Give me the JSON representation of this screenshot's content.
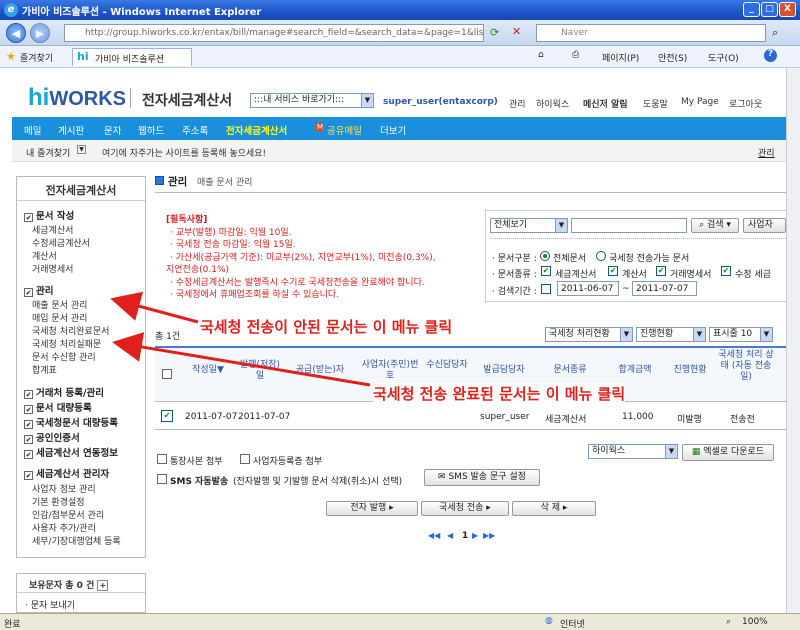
{
  "window": {
    "title": "가비아 비즈솔루션 - Windows Internet Explorer",
    "min": "_",
    "max": "□",
    "close": "X"
  },
  "browser": {
    "address": "http://group.hiworks.co.kr/entax/bill/manage#search_field=&search_data=&page=1&listcoun",
    "search_placeholder": "Naver",
    "favorites": "즐겨찾기",
    "tab": "가비아 비즈솔루션",
    "menu": {
      "page": "페이지(P)",
      "safety": "안전(S)",
      "tools": "도구(O)",
      "help": "?"
    }
  },
  "header": {
    "logo_hi": "hi",
    "logo_works": "WORKS",
    "service": "전자세금계산서",
    "shortcut": ":::내 서비스 바로가기:::",
    "user": "super_user(entaxcorp)",
    "links": [
      "관리",
      "하이웍스",
      "메신저 알림",
      "도움말",
      "My Page",
      "로그아웃"
    ]
  },
  "nav": {
    "items": [
      "메일",
      "게시판",
      "문자",
      "웹하드",
      "주소록",
      "전자세금계산서",
      "공유메일",
      "더보기"
    ]
  },
  "favbar": {
    "label": "내 즐겨찾기",
    "text": "여기에 자주가는 사이트를 등록해 놓으세요!",
    "manage": "관리"
  },
  "sidebar": {
    "title": "전자세금계산서",
    "sections": [
      {
        "label": "문서 작성",
        "items": [
          "세금계산서",
          "수정세금계산서",
          "계산서",
          "거래명세서"
        ]
      },
      {
        "label": "관리",
        "items": [
          "매출 문서 관리",
          "매입 문서 관리",
          "국세청 처리완료문서",
          "국세청 처리실패문",
          "문서 수신함 관리",
          "합계표"
        ]
      },
      {
        "label": "거래처 등록/관리",
        "items": []
      },
      {
        "label": "문서 대량등록",
        "items": []
      },
      {
        "label": "국세청문서 대량등록",
        "items": []
      },
      {
        "label": "공인인증서",
        "items": []
      },
      {
        "label": "세금계산서 연동정보",
        "items": []
      },
      {
        "label": "세금계산서 관리자",
        "items": [
          "사업자 정보 관리",
          "기본 환경설정",
          "인감/첨부문서 관리",
          "사용자 추가/관리",
          "세무/기장대행업체 등록"
        ]
      }
    ],
    "sms_title": "보유문자 총 0 건",
    "sms_item": "· 문자 보내기"
  },
  "main": {
    "title": "관리",
    "subtitle": "매출 문서 관리",
    "notice": {
      "title": "[필독사항]",
      "lines": [
        "· 교부(발행) 마감일: 익월 10일.",
        "· 국세청 전송 마감일: 익월 15일.",
        "· 가산세(공급가액 기준): 미교부(2%), 지연교부(1%), 미전송(0.3%),",
        "지연전송(0.1%)",
        "· 수정세금계산서는 발행즉시 수기로 국세청전송을 완료해야 합니다.",
        "· 국세청에서 휴폐업조회를 하실 수 있습니다."
      ]
    },
    "filter": {
      "view_all": "전체보기",
      "search": "검색",
      "biz_search": "사업자",
      "doc_type_label": "· 문서구분 :",
      "doc_all": "전체문서",
      "doc_nts": "국세청 전송가능 문서",
      "doc_kind_label": "· 문서종류 :",
      "kinds": [
        "세금계산서",
        "계산서",
        "거래명세서",
        "수정 세금"
      ],
      "period_label": "· 검색기간 :",
      "date_from": "2011-06-07",
      "date_to": "2011-07-07",
      "tilde": "~"
    },
    "count": "총 1건",
    "selects": {
      "nts_status": "국세청 처리현황",
      "progress": "진행현황",
      "page_size": "표시줄 10"
    },
    "table": {
      "headers": [
        "작성일▼",
        "발행(저장)일",
        "공급(받는)자",
        "사업자(주민)번호",
        "수신담당자",
        "발급담당자",
        "문서종류",
        "합계금액",
        "진행현황",
        "국세청 처리 상태 (자동 전송일)"
      ],
      "rows": [
        [
          "2011-07-07",
          "2011-07-07",
          "",
          "",
          "",
          "super_user",
          "세금계산서",
          "11,000",
          "미발행",
          "전송전"
        ]
      ]
    },
    "options": {
      "attach_bank": "통장사본 첨부",
      "attach_biz": "사업자등록증 첨부",
      "sms_label": "SMS 자동발송",
      "sms_desc": "(전자발행 및 기발행 문서 삭제(취소)시 선택)",
      "sms_btn": "SMS 발송 문구 설정",
      "hiworks_sel": "하이웍스",
      "excel_btn": "엑셀로 다운로드"
    },
    "actions": [
      "전자 발행",
      "국세청 전송",
      "삭 제"
    ],
    "pager": {
      "page": "1"
    }
  },
  "annotations": {
    "top": "국세청 전송이 안된 문서는 이 메뉴 클릭",
    "bottom": "국세청 전송 완료된 문서는 이 메뉴 클릭"
  },
  "statusbar": {
    "left": "완료",
    "zone": "인터넷",
    "zoom": "100%"
  },
  "colors": {
    "nav": "#1a8fdc",
    "annotation": "#e0201c",
    "active_nav": "#ffff00"
  }
}
